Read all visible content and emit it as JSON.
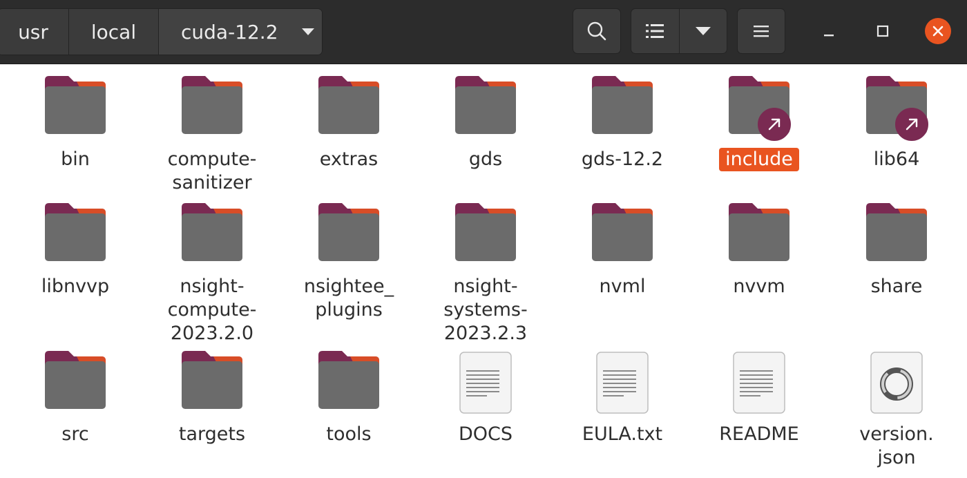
{
  "breadcrumbs": [
    "usr",
    "local",
    "cuda-12.2"
  ],
  "header": {
    "search_icon": "search-icon",
    "view_icon": "list-view-icon",
    "view_options_icon": "chevron-down-icon",
    "menu_icon": "hamburger-menu-icon"
  },
  "window_controls": [
    "minimize-icon",
    "maximize-icon",
    "close-icon"
  ],
  "colors": {
    "accent": "#e95420",
    "headerbar": "#2c2c2c",
    "folder_tab": "#7a2a52",
    "folder_body": "#6b6b6b",
    "symlink_badge": "#7a2a52"
  },
  "items": [
    {
      "name": "bin",
      "type": "folder"
    },
    {
      "name": "compute-\nsanitizer",
      "type": "folder"
    },
    {
      "name": "extras",
      "type": "folder"
    },
    {
      "name": "gds",
      "type": "folder"
    },
    {
      "name": "gds-12.2",
      "type": "folder"
    },
    {
      "name": "include",
      "type": "folder-link",
      "selected": true
    },
    {
      "name": "lib64",
      "type": "folder-link"
    },
    {
      "name": "libnvvp",
      "type": "folder"
    },
    {
      "name": "nsight-\ncompute-\n2023.2.0",
      "type": "folder"
    },
    {
      "name": "nsightee_\nplugins",
      "type": "folder"
    },
    {
      "name": "nsight-\nsystems-\n2023.2.3",
      "type": "folder"
    },
    {
      "name": "nvml",
      "type": "folder"
    },
    {
      "name": "nvvm",
      "type": "folder"
    },
    {
      "name": "share",
      "type": "folder"
    },
    {
      "name": "src",
      "type": "folder"
    },
    {
      "name": "targets",
      "type": "folder"
    },
    {
      "name": "tools",
      "type": "folder"
    },
    {
      "name": "DOCS",
      "type": "text"
    },
    {
      "name": "EULA.txt",
      "type": "text"
    },
    {
      "name": "README",
      "type": "text"
    },
    {
      "name": "version.\njson",
      "type": "json"
    }
  ]
}
